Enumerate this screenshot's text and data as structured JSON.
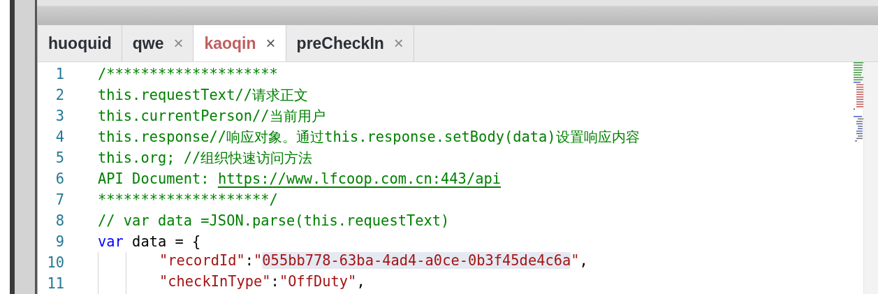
{
  "tabs": [
    {
      "label": "huoquid",
      "selected": false
    },
    {
      "label": "qwe",
      "selected": false,
      "close": "×"
    },
    {
      "label": "kaoqin",
      "selected": true,
      "close": "×"
    },
    {
      "label": "preCheckIn",
      "selected": false,
      "close": "×"
    }
  ],
  "editor": {
    "lines": [
      {
        "number": "1",
        "segments": [
          {
            "kind": "comment",
            "text": "/********************"
          }
        ]
      },
      {
        "number": "2",
        "segments": [
          {
            "kind": "comment",
            "text": "this.requestText//请求正文"
          }
        ]
      },
      {
        "number": "3",
        "segments": [
          {
            "kind": "comment",
            "text": "this.currentPerson//当前用户"
          }
        ]
      },
      {
        "number": "4",
        "segments": [
          {
            "kind": "comment",
            "text": "this.response//响应对象。通过this.response.setBody(data)设置响应内容"
          }
        ]
      },
      {
        "number": "5",
        "segments": [
          {
            "kind": "comment",
            "text": "this.org; //组织快速访问方法"
          }
        ]
      },
      {
        "number": "6",
        "segments": [
          {
            "kind": "comment",
            "text": "API Document: "
          },
          {
            "kind": "link",
            "text": "https://www.lfcoop.com.cn:443/api"
          }
        ]
      },
      {
        "number": "7",
        "segments": [
          {
            "kind": "comment",
            "text": "********************/"
          }
        ]
      },
      {
        "number": "8",
        "segments": [
          {
            "kind": "comment",
            "text": "// var data =JSON.parse(this.requestText)"
          }
        ]
      },
      {
        "number": "9",
        "segments": [
          {
            "kind": "keyword",
            "text": "var"
          },
          {
            "kind": "plain",
            "text": " data = {"
          }
        ],
        "children": [
          {
            "number": "10",
            "segments": [
              {
                "kind": "string",
                "text": "\"recordId\""
              },
              {
                "kind": "plain",
                "text": ":"
              },
              {
                "kind": "string",
                "text": "\""
              },
              {
                "kind": "highlighted-string",
                "text": "055bb778-63ba-4ad4-a0ce-0b3f45de4c6a"
              },
              {
                "kind": "string",
                "text": "\""
              },
              {
                "kind": "plain",
                "text": ","
              }
            ]
          },
          {
            "number": "11",
            "segments": [
              {
                "kind": "string",
                "text": "\"checkInType\""
              },
              {
                "kind": "plain",
                "text": ":"
              },
              {
                "kind": "string",
                "text": "\"OffDuty\""
              },
              {
                "kind": "plain",
                "text": ","
              }
            ]
          }
        ]
      }
    ]
  }
}
